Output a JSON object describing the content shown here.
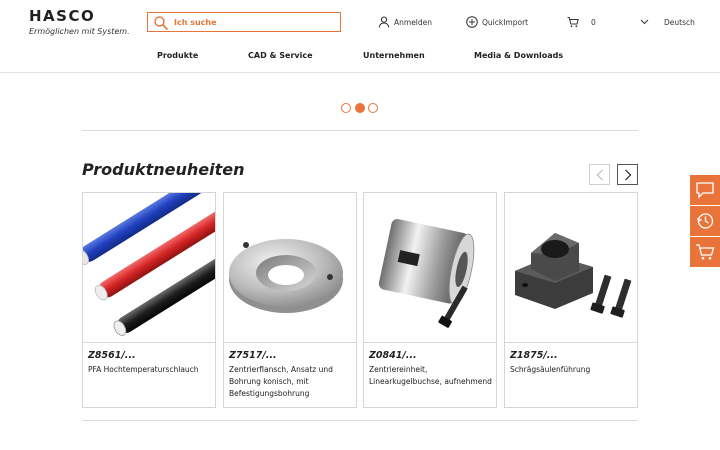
{
  "header": {
    "logo_word": "HASCO",
    "logo_tagline": "Ermöglichen mit System.",
    "search_placeholder": "Ich suche",
    "login_label": "Anmelden",
    "quickimport_label": "QuickImport",
    "cart_count": "0",
    "language": "Deutsch"
  },
  "nav": {
    "items": [
      "Produkte",
      "CAD & Service",
      "Unternehmen",
      "Media & Downloads"
    ]
  },
  "carousel": {
    "dots": 3,
    "active_index": 1
  },
  "section": {
    "title": "Produktneuheiten"
  },
  "products": [
    {
      "code": "Z8561/...",
      "description": "PFA Hochtemperaturschlauch"
    },
    {
      "code": "Z7517/...",
      "description": "Zentrierflansch, Ansatz und Bohrung konisch, mit Befestigungsbohrung"
    },
    {
      "code": "Z0841/...",
      "description": "Zentriereinheit, Linearkugelbuchse, aufnehmend"
    },
    {
      "code": "Z1875/...",
      "description": "Schrägsäulenführung"
    }
  ],
  "side_actions": [
    "chat-icon",
    "history-icon",
    "cart-icon"
  ],
  "colors": {
    "accent": "#e8743b"
  }
}
